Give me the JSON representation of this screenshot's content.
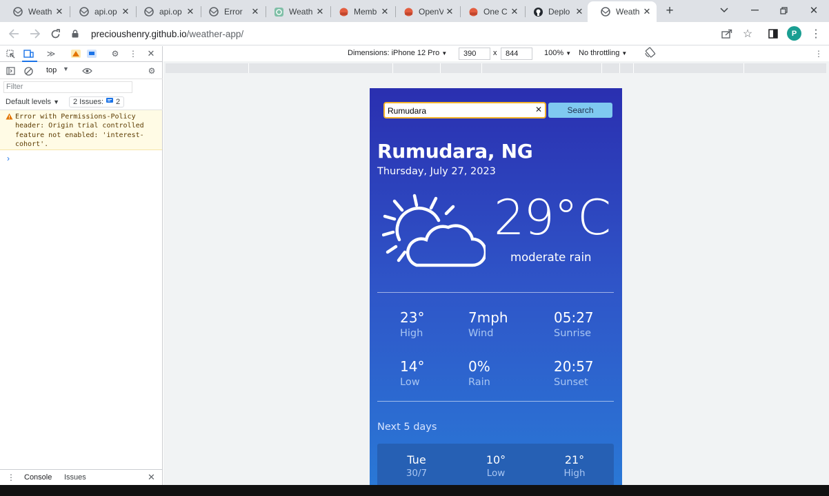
{
  "browser": {
    "tabs": [
      {
        "title": "Weath",
        "icon": "globe-icon"
      },
      {
        "title": "api.op",
        "icon": "globe-icon"
      },
      {
        "title": "api.op",
        "icon": "globe-icon"
      },
      {
        "title": "Error",
        "icon": "globe-icon"
      },
      {
        "title": "Weath",
        "icon": "chatgpt-icon"
      },
      {
        "title": "Memb",
        "icon": "openweather-icon"
      },
      {
        "title": "OpenV",
        "icon": "openweather-icon"
      },
      {
        "title": "One C",
        "icon": "openweather-icon"
      },
      {
        "title": "Deplo",
        "icon": "github-icon"
      },
      {
        "title": "Weath",
        "icon": "globe-icon"
      }
    ],
    "url_host": "precioushenry.github.io",
    "url_path": "/weather-app/",
    "profile_initial": "P"
  },
  "devtools": {
    "context": "top",
    "filter_placeholder": "Filter",
    "levels": "Default levels",
    "issues_label": "2 Issues:",
    "issues_count": "2",
    "warning_text": "Error with Permissions-Policy header: Origin trial controlled feature not enabled: 'interest-cohort'.",
    "bottom_tabs": [
      "Console",
      "Issues"
    ]
  },
  "device_toolbar": {
    "dimensions_label": "Dimensions: iPhone 12 Pro",
    "width": "390",
    "times": "x",
    "height": "844",
    "zoom": "100%",
    "throttling": "No throttling"
  },
  "weather": {
    "search_value": "Rumudara",
    "search_button": "Search",
    "location": "Rumudara, NG",
    "date": "Thursday, July 27, 2023",
    "temperature": "29°C",
    "condition": "moderate rain",
    "stats": [
      {
        "value": "23°",
        "label": "High"
      },
      {
        "value": "7mph",
        "label": "Wind"
      },
      {
        "value": "05:27",
        "label": "Sunrise"
      },
      {
        "value": "14°",
        "label": "Low"
      },
      {
        "value": "0%",
        "label": "Rain"
      },
      {
        "value": "20:57",
        "label": "Sunset"
      }
    ],
    "next_title": "Next 5 days",
    "forecast": [
      {
        "day": "Tue",
        "date": "30/7",
        "low": "10°",
        "low_label": "Low",
        "high": "21°",
        "high_label": "High"
      }
    ]
  }
}
